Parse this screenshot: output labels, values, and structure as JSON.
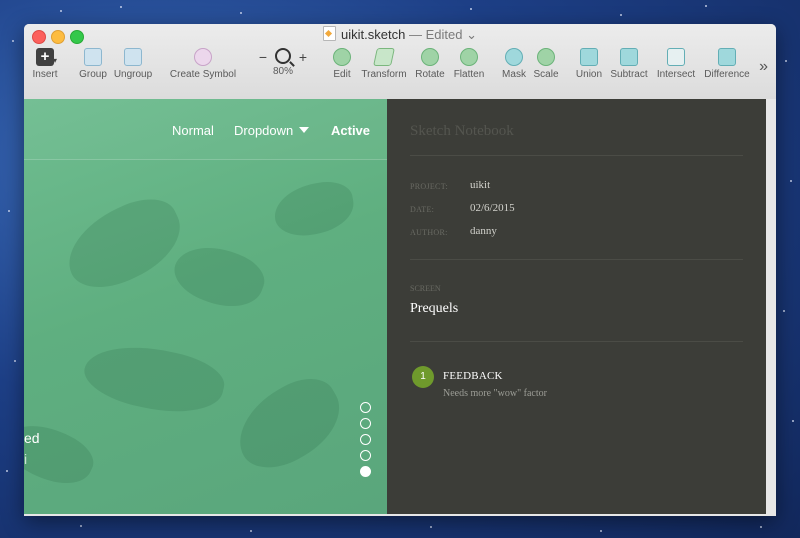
{
  "window": {
    "filename": "uikit.sketch",
    "status": "— Edited",
    "status_chevron": "⌄"
  },
  "toolbar": {
    "insert": "Insert",
    "group": "Group",
    "ungroup": "Ungroup",
    "create_symbol": "Create Symbol",
    "zoom_level": "80%",
    "zoom_minus": "−",
    "zoom_plus": "+",
    "edit": "Edit",
    "transform": "Transform",
    "rotate": "Rotate",
    "flatten": "Flatten",
    "mask": "Mask",
    "scale": "Scale",
    "union": "Union",
    "subtract": "Subtract",
    "intersect": "Intersect",
    "difference": "Difference",
    "more": "»"
  },
  "preview": {
    "nav_normal": "Normal",
    "nav_dropdown": "Dropdown",
    "nav_active": "Active",
    "cut_text_1": "ed",
    "cut_text_2": "i",
    "pagination_active_index": 4,
    "pagination_count": 5
  },
  "notebook": {
    "title": "Sketch Notebook",
    "project_label": "PROJECT:",
    "project_value": "uikit",
    "date_label": "DATE:",
    "date_value": "02/6/2015",
    "author_label": "AUTHOR:",
    "author_value": "danny",
    "screen_label": "SCREEN",
    "screen_value": "Prequels",
    "feedback": {
      "number": "1",
      "title": "FEEDBACK",
      "note": "Needs more \"wow\" factor"
    }
  },
  "colors": {
    "green_panel": "#63b184",
    "dark_panel": "#3c3d38",
    "feedback_badge": "#6f9a2c"
  }
}
